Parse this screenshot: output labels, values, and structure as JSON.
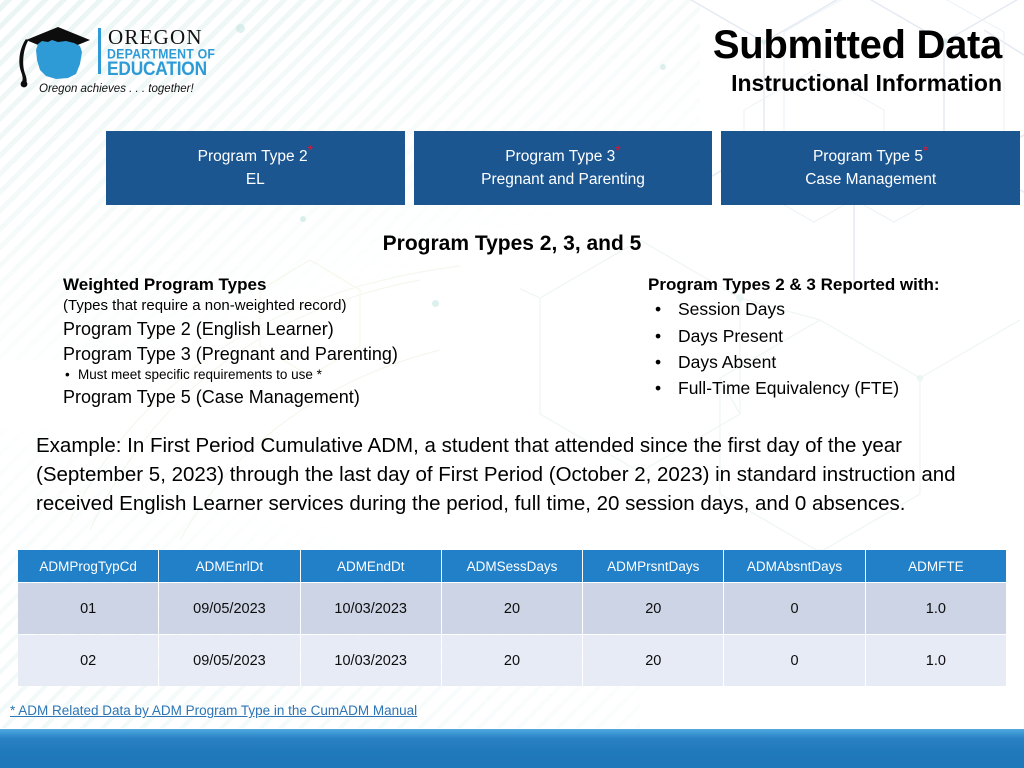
{
  "logo": {
    "org_line1": "OREGON",
    "org_line2": "DEPARTMENT OF",
    "org_line3": "EDUCATION",
    "tagline": "Oregon achieves . . . together!",
    "accent_color": "#2E9BD6",
    "cap_color": "#0d0d0d"
  },
  "header": {
    "title": "Submitted Data",
    "subtitle": "Instructional Information"
  },
  "cards": [
    {
      "label": "Program Type 2",
      "asterisk": "*",
      "detail": "EL"
    },
    {
      "label": "Program Type 3",
      "asterisk": "*",
      "detail": "Pregnant and Parenting"
    },
    {
      "label": "Program Type 5",
      "asterisk": "*",
      "detail": "Case Management"
    }
  ],
  "section_heading": "Program Types 2, 3, and 5",
  "left_column": {
    "heading": "Weighted Program Types",
    "note": "(Types that require a non-weighted record)",
    "type2": "Program Type 2 (English Learner)",
    "type3": "Program Type 3 (Pregnant and Parenting)",
    "type3_sub": "Must meet specific requirements to use *",
    "type5": "Program Type 5 (Case Management)"
  },
  "right_column": {
    "heading": "Program Types 2 & 3 Reported with:",
    "bullets": [
      "Session Days",
      "Days Present",
      "Days Absent",
      "Full-Time Equivalency (FTE)"
    ]
  },
  "example": "Example: In First Period Cumulative ADM, a student that attended since the first day of the year (September 5, 2023) through the last day of First Period (October 2, 2023) in standard instruction and received English Learner services during the period, full time, 20 session days, and 0 absences.",
  "table": {
    "headers": [
      "ADMProgTypCd",
      "ADMEnrlDt",
      "ADMEndDt",
      "ADMSessDays",
      "ADMPrsntDays",
      "ADMAbsntDays",
      "ADMFTE"
    ],
    "rows": [
      [
        "01",
        "09/05/2023",
        "10/03/2023",
        "20",
        "20",
        "0",
        "1.0"
      ],
      [
        "02",
        "09/05/2023",
        "10/03/2023",
        "20",
        "20",
        "0",
        "1.0"
      ]
    ]
  },
  "footnote": "* ADM Related Data by ADM Program Type in the CumADM Manual",
  "colors": {
    "card_blue": "#1B5691",
    "table_header_blue": "#2180C8",
    "row_a": "#ccd4e5",
    "row_b": "#e7ebf5",
    "asterisk_red": "#E8112D",
    "link_blue": "#2E75B6",
    "bottom_bar_blue": "#2079bb"
  }
}
